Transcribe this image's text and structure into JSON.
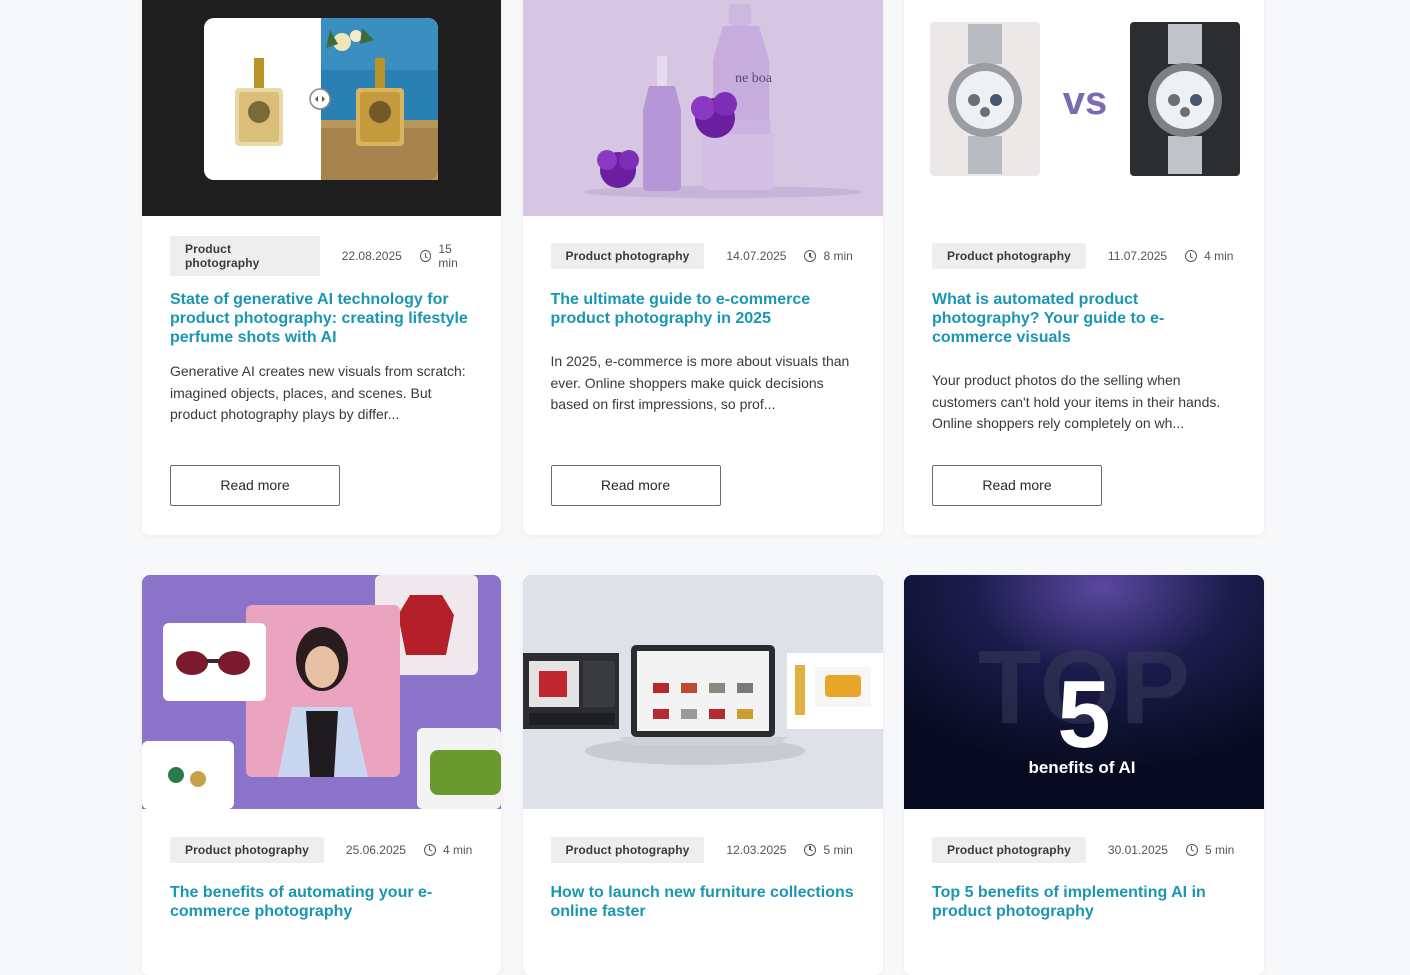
{
  "posts": [
    {
      "tag": "Product photography",
      "date": "22.08.2025",
      "read_time": "15 min",
      "title": "State of generative AI technology for product photography: creating lifestyle perfume shots with AI",
      "excerpt": "Generative AI creates new visuals from scratch: imagined objects, places, and scenes. But product photography plays by differ...",
      "button": "Read more"
    },
    {
      "tag": "Product photography",
      "date": "14.07.2025",
      "read_time": "8 min",
      "title": "The ultimate guide to e-commerce product photography in 2025",
      "excerpt": "In 2025, e-commerce is more about visuals than ever. Online shoppers make quick decisions based on first impressions, so prof...",
      "button": "Read more",
      "image_brand": "ne boa"
    },
    {
      "tag": "Product photography",
      "date": "11.07.2025",
      "read_time": "4 min",
      "title": "What is automated product photography? Your guide to e-commerce visuals",
      "excerpt": "Your product photos do the selling when customers can't hold your items in their hands. Online shoppers rely completely on wh...",
      "button": "Read more",
      "image_text": "vs"
    },
    {
      "tag": "Product photography",
      "date": "25.06.2025",
      "read_time": "4 min",
      "title": "The benefits of automating your e-commerce photography"
    },
    {
      "tag": "Product photography",
      "date": "12.03.2025",
      "read_time": "5 min",
      "title": "How to launch new furniture collections online faster"
    },
    {
      "tag": "Product photography",
      "date": "30.01.2025",
      "read_time": "5 min",
      "title": "Top 5 benefits of implementing AI in product photography",
      "image_big": "TOP",
      "image_num": "5",
      "image_caption": "benefits of AI"
    }
  ],
  "colors": {
    "title": "#1a96b2",
    "tag_bg": "#eeeeee",
    "accent_purple": "#7b6bb0"
  }
}
